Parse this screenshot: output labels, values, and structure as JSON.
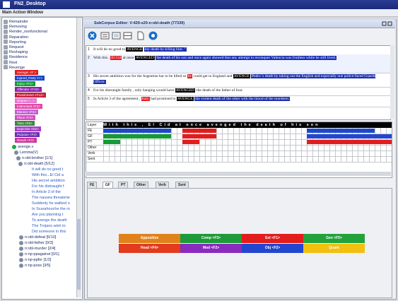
{
  "window": {
    "title": "FN2_Desktop"
  },
  "menu": [
    "Main",
    "Action",
    "Window"
  ],
  "tree": {
    "top_items": [
      "Remainder",
      "Removing",
      "Render_nonfunctional",
      "Reparation",
      "Reporting",
      "Request",
      "Reshaping",
      "Residence",
      "Rest",
      "Revenge"
    ],
    "fe_tags": [
      {
        "label": "Avenger <F >",
        "color": "#e21d1d"
      },
      {
        "label": "Injured_Party <I >",
        "color": "#1d49c9"
      },
      {
        "label": "Injury <F1>",
        "color": "#149b35"
      },
      {
        "label": "Offender <F10>",
        "color": "#8c1fb3"
      },
      {
        "label": "Punishment <F12>",
        "color": "#c41f3a"
      },
      {
        "label": "Degree <...>",
        "color": "#e874cf"
      },
      {
        "label": "Instrument <F2>",
        "color": "#e04aa6"
      },
      {
        "label": "Manner <F4>",
        "color": "#c45fd6"
      },
      {
        "label": "Place <F4>",
        "color": "#d54bc0"
      },
      {
        "label": "Time <F5>",
        "color": "#3a8b3a"
      },
      {
        "label": "Depictive <D2>",
        "color": "#a43fc6"
      },
      {
        "label": "Purpose <F4>",
        "color": "#6e2cb8"
      },
      {
        "label": "Result <F3>",
        "color": "#c9379c"
      }
    ],
    "lower_items": [
      "avenge.v",
      "Lemma(V)",
      "n:obl-brother [1/1]",
      "n:obl-death [5/12]"
    ],
    "sentences": [
      "It will do no good t",
      "With this...El Cid a",
      "His secret ambition",
      "For his distraught f",
      "In Article 3 of the",
      "The nausea threatene",
      "Suddenly he walked o",
      "In Scarahouche the m",
      "Are you planning t",
      "To avenge the death",
      "The Trojans wish to",
      "Did someone in this"
    ],
    "more_items": [
      "n:obl-defeat [5/10]",
      "n:obl-father [0/3]",
      "n:obl-murder [2/4]",
      "n:np-ppagainst [0/1]",
      "n:np-ppfor [1/2]",
      "n:np-poss [3/5]"
    ]
  },
  "editor": {
    "title": "SubCorpus Editor: V-429-s20-n:obl-death (77339)",
    "sentences": [
      {
        "num": "1",
        "text": "It will do no good to",
        "hl": "AVENGE",
        "rest": "my death by killing him.  \""
      },
      {
        "num": "2",
        "text": "With this ,",
        "hl_a": "El Cid",
        "mid": "at once",
        "hl": "AVENGED",
        "rest": "the death of his son and once again showed that any attempt to reconquer Valencia was fruitless while he still lived."
      },
      {
        "num": "3",
        "text": "His secret ambition was for the Argentine bar to be lifted so",
        "hl_a": "he",
        "mid": "could get to England and",
        "hl": "AVENGE",
        "rest": "Pedro 's death by taking out the English and especially one police-faced Guards Officer."
      },
      {
        "num": "4",
        "text": "For his distraught family , only hanging would have",
        "hl": "AVENGED",
        "rest": "the death of the father of four."
      },
      {
        "num": "5",
        "text": "In Article 3 of the agreement ,",
        "hl_a": "Italy",
        "mid": "had promised to",
        "hl": "AVENGE",
        "rest": "the violent death of the other with the blood of the murderer."
      }
    ],
    "grid": {
      "header": "With this , El Cid at once avenged the death of his son",
      "layers": [
        "Layer",
        "FE",
        "GF",
        "PT",
        "Other",
        "Verb",
        "Sent"
      ]
    },
    "tabs": [
      "FE",
      "GF",
      "PT",
      "Other",
      "Verb",
      "Sent"
    ],
    "active_tab": "GF",
    "palette": [
      {
        "label": "Appositive",
        "color": "#e0821c"
      },
      {
        "label": "Comp <F3>",
        "color": "#1f9a3a"
      },
      {
        "label": "Ext <F1>",
        "color": "#e21d1d"
      },
      {
        "label": "Gen <F5>",
        "color": "#23a23b"
      },
      {
        "label": "Head <F4>",
        "color": "#e23b1d"
      },
      {
        "label": "Mod <F2>",
        "color": "#8a2bbf"
      },
      {
        "label": "Obj <F2>",
        "color": "#2346d1"
      },
      {
        "label": "Quant",
        "color": "#f2c010"
      }
    ]
  }
}
